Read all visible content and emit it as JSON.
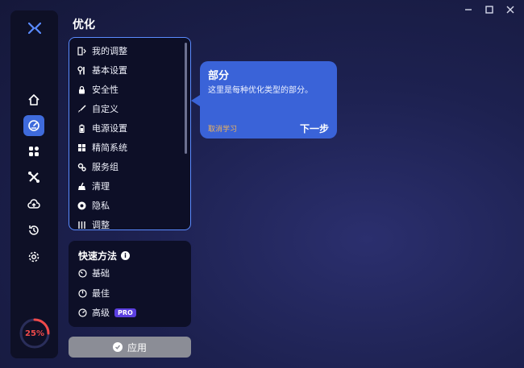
{
  "window": {
    "controls": [
      "minimize",
      "maximize",
      "close"
    ]
  },
  "sidebar": {
    "logo_icon": "x-logo-icon",
    "nav": [
      {
        "id": "home",
        "icon": "home-icon"
      },
      {
        "id": "optimize",
        "icon": "speedometer-icon",
        "active": true
      },
      {
        "id": "apps",
        "icon": "apps-grid-icon"
      },
      {
        "id": "tools",
        "icon": "tools-cross-icon"
      },
      {
        "id": "cloud",
        "icon": "cloud-upload-icon"
      },
      {
        "id": "history",
        "icon": "history-icon"
      },
      {
        "id": "settings",
        "icon": "gear-icon"
      }
    ],
    "progress_text": "25%",
    "progress_value": 0.25,
    "progress_color": "#f04a4a"
  },
  "main": {
    "title": "优化",
    "list_items": [
      {
        "label": "我的调整",
        "icon": "my-tweaks-icon"
      },
      {
        "label": "基本设置",
        "icon": "wrench-icon"
      },
      {
        "label": "安全性",
        "icon": "lock-icon"
      },
      {
        "label": "自定义",
        "icon": "brush-icon"
      },
      {
        "label": "电源设置",
        "icon": "battery-icon"
      },
      {
        "label": "精简系统",
        "icon": "windows-icon"
      },
      {
        "label": "服务组",
        "icon": "services-gear-icon"
      },
      {
        "label": "清理",
        "icon": "broom-icon"
      },
      {
        "label": "隐私",
        "icon": "privacy-eye-icon"
      },
      {
        "label": "调整",
        "icon": "sliders-icon"
      }
    ],
    "shortcut": {
      "title": "快速方法",
      "modes": [
        {
          "label": "基础",
          "icon": "gauge-low-icon"
        },
        {
          "label": "最佳",
          "icon": "gauge-mid-icon"
        },
        {
          "label": "高级",
          "icon": "gauge-high-icon",
          "badge": "PRO"
        }
      ]
    },
    "apply_label": "应用"
  },
  "tooltip": {
    "title": "部分",
    "body": "这里是每种优化类型的部分。",
    "skip_label": "取消学习",
    "next_label": "下一步"
  },
  "colors": {
    "accent": "#3a63d8",
    "panel_border": "#5a8bff",
    "pro_badge": "#5b3fe0",
    "skip_link": "#f0b35a"
  }
}
